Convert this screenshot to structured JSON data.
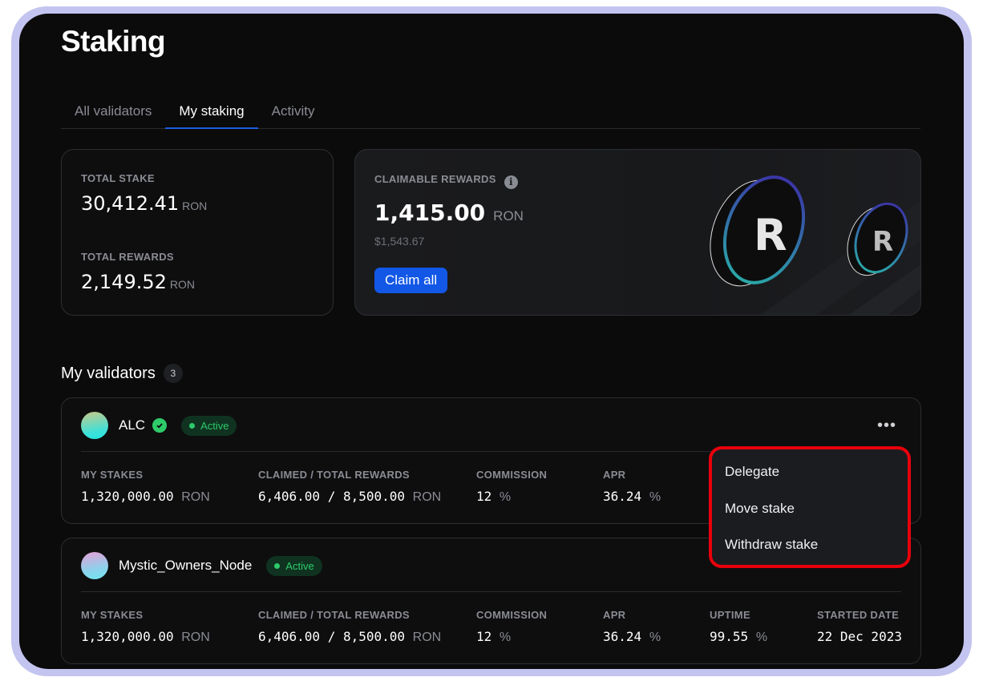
{
  "page": {
    "title": "Staking"
  },
  "tabs": [
    {
      "label": "All validators",
      "active": false
    },
    {
      "label": "My staking",
      "active": true
    },
    {
      "label": "Activity",
      "active": false
    }
  ],
  "summary": {
    "total_stake_label": "TOTAL STAKE",
    "total_stake_value": "30,412.41",
    "total_stake_unit": "RON",
    "total_rewards_label": "TOTAL REWARDS",
    "total_rewards_value": "2,149.52",
    "total_rewards_unit": "RON"
  },
  "claimable": {
    "label": "CLAIMABLE REWARDS",
    "info_icon": "info-icon",
    "value": "1,415.00",
    "unit": "RON",
    "usd": "$1,543.67",
    "button": "Claim all",
    "illustration": "ronin-coins"
  },
  "validators_section": {
    "title": "My validators",
    "count": "3"
  },
  "validators": [
    {
      "name": "ALC",
      "verified": true,
      "status": "Active",
      "stats": {
        "my_stakes_label": "MY STAKES",
        "my_stakes": "1,320,000.00",
        "my_stakes_unit": "RON",
        "rewards_label": "CLAIMED / TOTAL REWARDS",
        "claimed": "6,406.00",
        "total": "8,500.00",
        "rewards_unit": "RON",
        "commission_label": "COMMISSION",
        "commission": "12",
        "commission_unit": "%",
        "apr_label": "APR",
        "apr": "36.24",
        "apr_unit": "%"
      }
    },
    {
      "name": "Mystic_Owners_Node",
      "verified": false,
      "status": "Active",
      "stats": {
        "my_stakes_label": "MY STAKES",
        "my_stakes": "1,320,000.00",
        "my_stakes_unit": "RON",
        "rewards_label": "CLAIMED / TOTAL REWARDS",
        "claimed": "6,406.00",
        "total": "8,500.00",
        "rewards_unit": "RON",
        "commission_label": "COMMISSION",
        "commission": "12",
        "commission_unit": "%",
        "apr_label": "APR",
        "apr": "36.24",
        "apr_unit": "%",
        "uptime_label": "UPTIME",
        "uptime": "99.55",
        "uptime_unit": "%",
        "started_label": "STARTED DATE",
        "started": "22 Dec 2023"
      }
    }
  ],
  "menu": {
    "more_icon": "•••",
    "items": [
      "Delegate",
      "Move stake",
      "Withdraw stake"
    ],
    "highlight_color": "#e8000b"
  },
  "colors": {
    "accent": "#1257e6",
    "active_green": "#2ecb6a",
    "frame": "#c3c4ef"
  }
}
